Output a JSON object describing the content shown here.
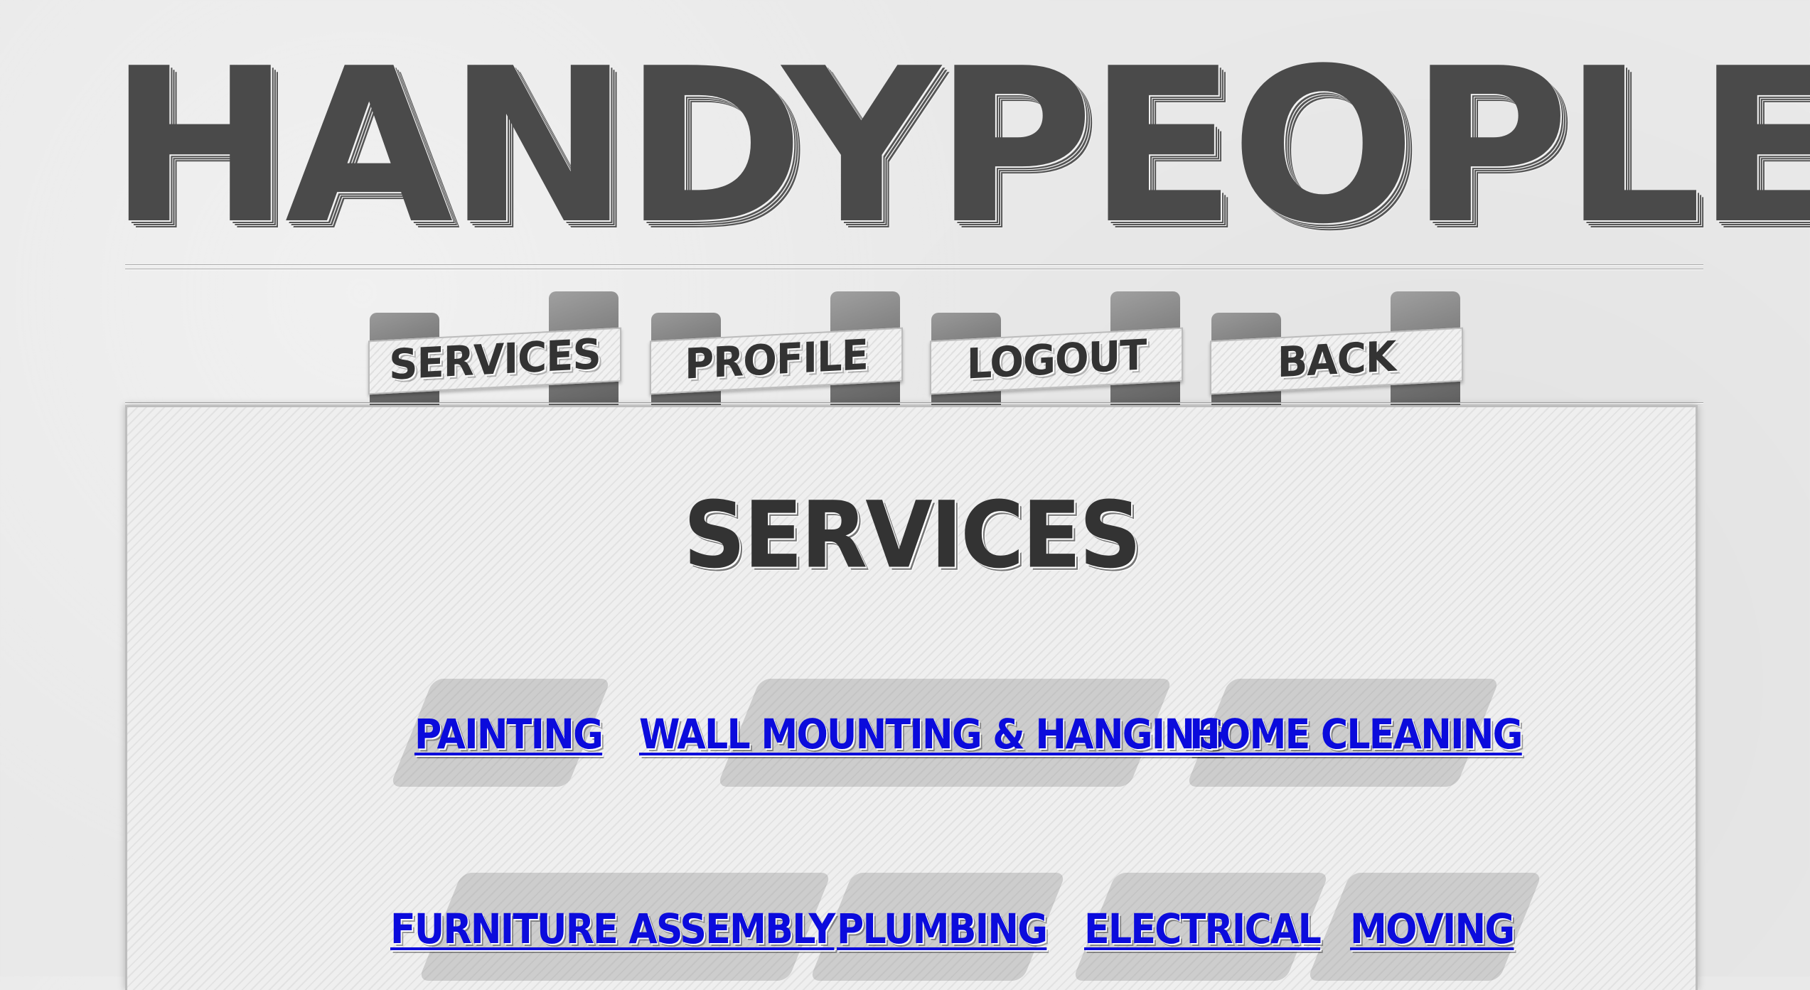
{
  "header": {
    "logo_text": "HANDYPEOPLE"
  },
  "nav": {
    "tabs": [
      {
        "label": "SERVICES"
      },
      {
        "label": "PROFILE"
      },
      {
        "label": "LOGOUT"
      },
      {
        "label": "BACK"
      }
    ]
  },
  "main": {
    "title": "SERVICES",
    "services": [
      {
        "label": "PAINTING"
      },
      {
        "label": "WALL MOUNTING & HANGING"
      },
      {
        "label": "HOME CLEANING"
      },
      {
        "label": "FURNITURE ASSEMBLY"
      },
      {
        "label": "PLUMBING"
      },
      {
        "label": "ELECTRICAL"
      },
      {
        "label": "MOVING"
      }
    ]
  },
  "colors": {
    "background": "#e9e9e9",
    "text_dark": "#4a4a4a",
    "link": "#0b0bdc",
    "panel": "#efefef"
  }
}
